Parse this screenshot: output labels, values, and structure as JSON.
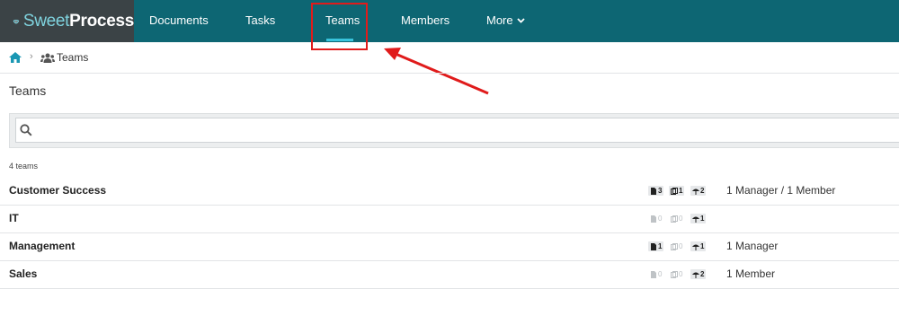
{
  "brand": {
    "sweet": "Sweet",
    "process": "Process"
  },
  "nav": {
    "documents": "Documents",
    "tasks": "Tasks",
    "teams": "Teams",
    "members": "Members",
    "more": "More"
  },
  "breadcrumb": {
    "current": "Teams"
  },
  "page": {
    "title": "Teams",
    "count_text": "4 teams"
  },
  "search": {
    "placeholder": "",
    "value": ""
  },
  "teams": [
    {
      "name": "Customer Success",
      "documents": "3",
      "procedures": "1",
      "policies": "2",
      "roles": "1 Manager / 1 Member"
    },
    {
      "name": "IT",
      "documents": "0",
      "procedures": "0",
      "policies": "1",
      "roles": ""
    },
    {
      "name": "Management",
      "documents": "1",
      "procedures": "0",
      "policies": "1",
      "roles": "1 Manager"
    },
    {
      "name": "Sales",
      "documents": "0",
      "procedures": "0",
      "policies": "2",
      "roles": "1 Member"
    }
  ],
  "colors": {
    "nav_bg": "#0d6673",
    "logo_bg": "#3b4346",
    "active_underline": "#39c3dc",
    "annotation": "#e01b1b"
  },
  "icons": {
    "logo": "sweetprocess-logo-icon",
    "home": "home-icon",
    "team": "team-icon",
    "search": "search-icon",
    "document": "document-icon",
    "procedure": "procedure-icon",
    "policy": "umbrella-icon",
    "chevron": "chevron-down-icon"
  }
}
